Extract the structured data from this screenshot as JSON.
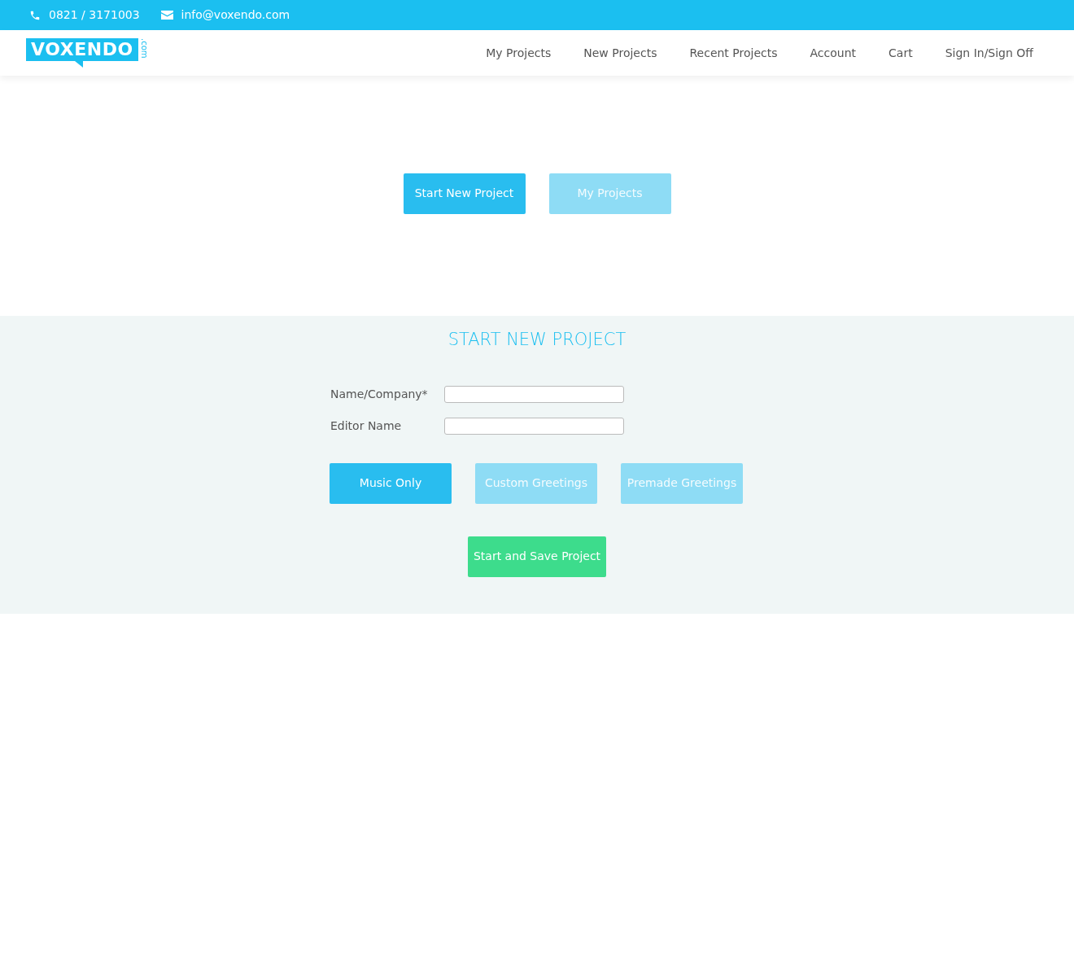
{
  "topbar": {
    "phone": "0821 / 3171003",
    "email": "info@voxendo.com"
  },
  "logo": {
    "name": "VOXENDO",
    "suffix": ".com"
  },
  "nav": [
    {
      "label": "My Projects"
    },
    {
      "label": "New Projects"
    },
    {
      "label": "Recent Projects"
    },
    {
      "label": "Account"
    },
    {
      "label": "Cart"
    },
    {
      "label": "Sign In/Sign Off"
    }
  ],
  "mode_buttons": [
    {
      "label": "Start New Project",
      "selected": true
    },
    {
      "label": "My Projects",
      "selected": false
    }
  ],
  "form": {
    "title": "START NEW PROJECT",
    "fields": [
      {
        "label": "Name/Company*"
      },
      {
        "label": "Editor Name"
      }
    ],
    "type_buttons": [
      {
        "label": "Music Only",
        "selected": true
      },
      {
        "label": "Custom Greetings",
        "selected": false
      },
      {
        "label": "Premade Greetings",
        "selected": false
      }
    ],
    "submit": "Start and Save Project"
  }
}
